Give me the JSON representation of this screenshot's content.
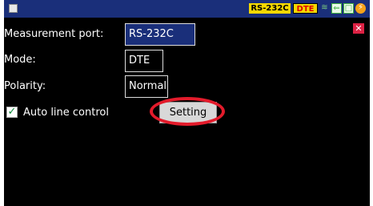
{
  "status_bar": {
    "port_badge": "RS-232C",
    "mode_badge": "DTE",
    "icons": [
      "menu-square-icon",
      "signal-wave-icon",
      "line-arrow-icon",
      "record-box-icon",
      "power-bolt-icon"
    ]
  },
  "form": {
    "port_label": "Measurement port:",
    "port_value": "RS-232C",
    "mode_label": "Mode:",
    "mode_value": "DTE",
    "polarity_label": "Polarity:",
    "polarity_value": "Normal",
    "auto_line_label": "Auto line control",
    "auto_line_checked": true,
    "setting_button": "Setting"
  },
  "colors": {
    "screen_bg": "#000000",
    "status_bar_bg": "#1a2f7a",
    "badge_bg": "#f4d800",
    "dte_text": "#dd0000",
    "highlight": "#e31b2b"
  }
}
